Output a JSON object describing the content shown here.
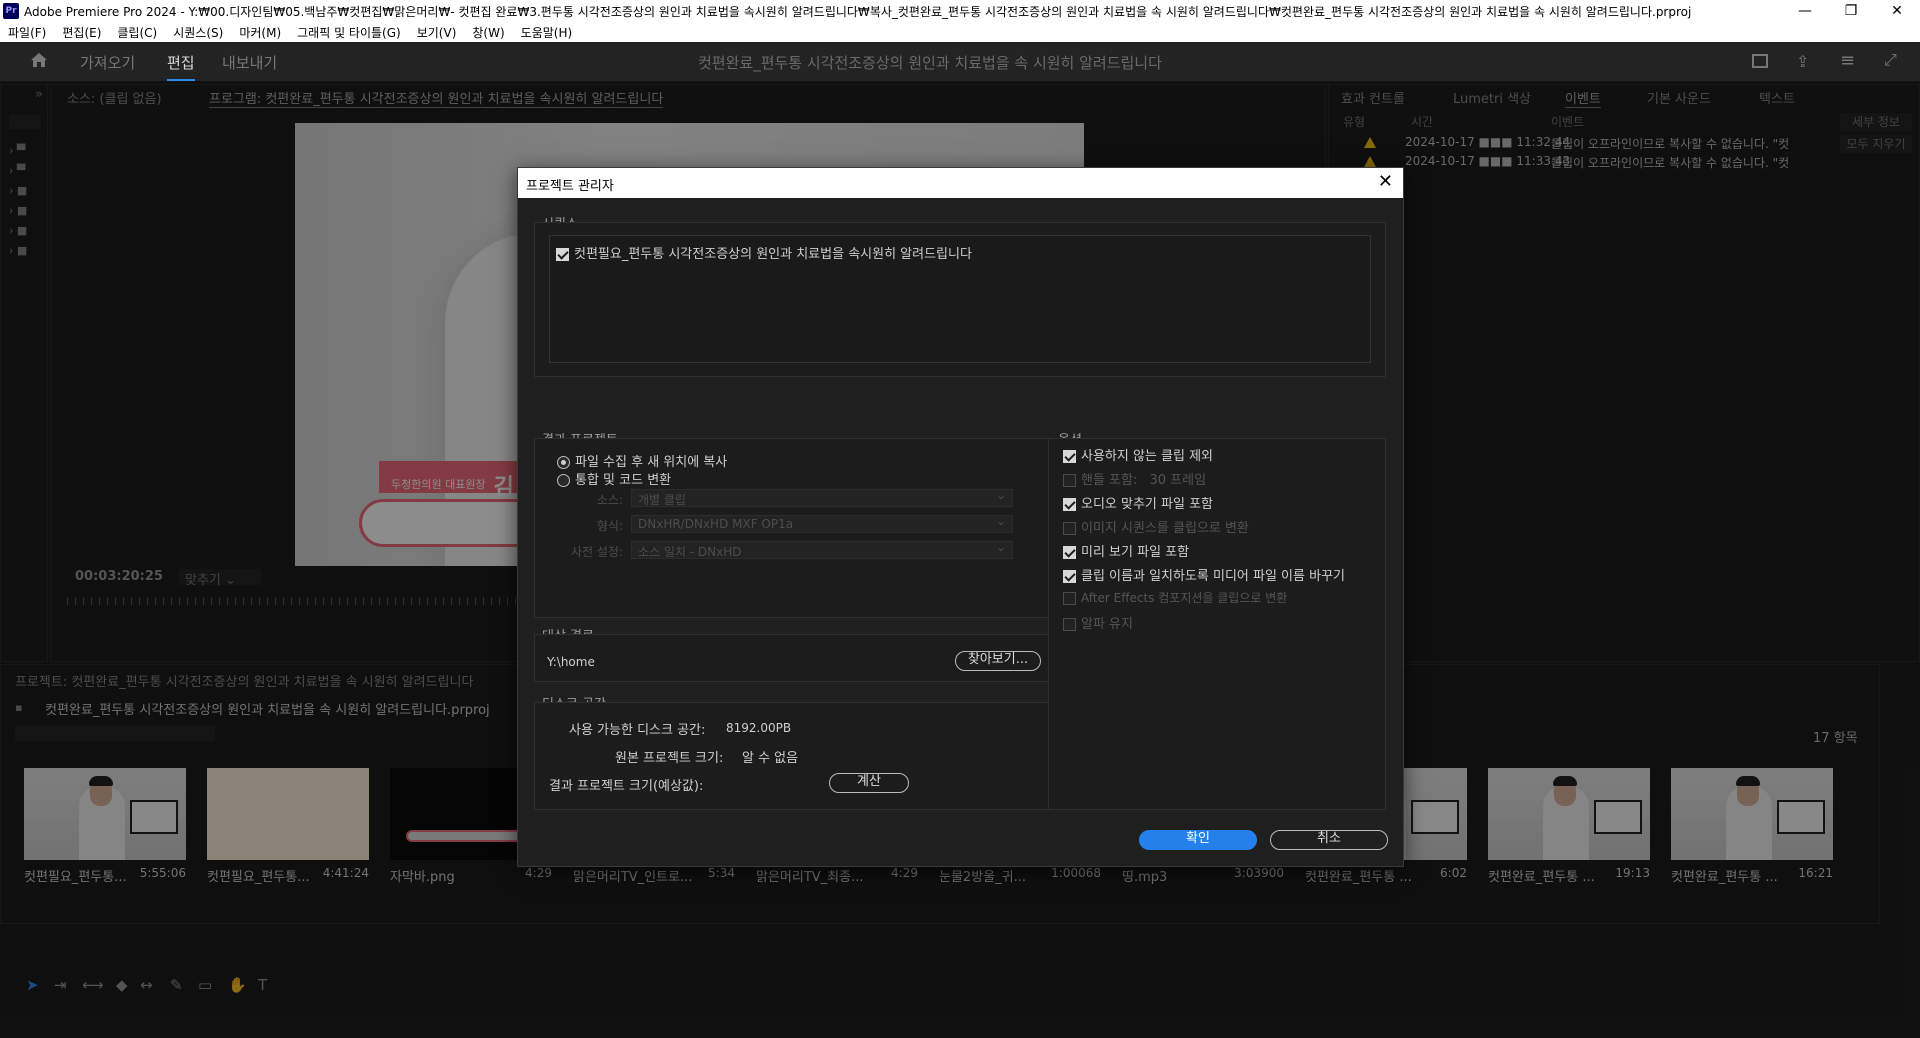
{
  "titlebar": {
    "app_icon": "Pr",
    "title": "Adobe Premiere Pro 2024 - Y:₩00.디자인팀₩05.백남주₩컷편집₩맑은머리₩- 컷편집 완료₩3.편두통 시각전조증상의 원인과 치료법을 속시원히 알려드립니다₩복사_컷편완료_편두통 시각전조증상의 원인과 치료법을 속 시원히 알려드립니다₩컷편완료_편두통 시각전조증상의 원인과 치료법을 속 시원히 알려드립니다.prproj",
    "minimize": "—",
    "maximize": "❐",
    "close": "✕"
  },
  "menu": [
    "파일(F)",
    "편집(E)",
    "클립(C)",
    "시퀀스(S)",
    "마커(M)",
    "그래픽 및 타이틀(G)",
    "보기(V)",
    "창(W)",
    "도움말(H)"
  ],
  "appbar": {
    "tabs": [
      "가져오기",
      "편집",
      "내보내기"
    ],
    "active": "편집",
    "doc_title": "컷편완료_편두통 시각전조증상의 원인과 치료법을 속 시원히 알려드립니다"
  },
  "source_panel": {
    "source_tab": "소스: (클립 없음)",
    "program_tab": "프로그램: 컷편완료_편두통 시각전조증상의 원인과 치료법을 속시원히 알려드립니다",
    "timecode": "00:03:20:25",
    "fit": "맞추기",
    "lower_third": "두청한의원 대표원장",
    "lower_third_name": "김"
  },
  "effects_panel": {
    "tabs": [
      "효과 컨트롤",
      "Lumetri 색상",
      "이벤트",
      "기본 사운드",
      "텍스트"
    ],
    "active": "이벤트",
    "columns": [
      "유형",
      "시간",
      "이벤트"
    ],
    "rows": [
      {
        "time": "2024-10-17 ■■■ 11:32:44",
        "event": "클립이 오프라인이므로 복사할 수 없습니다. \"컷"
      },
      {
        "time": "2024-10-17 ■■■ 11:33:43",
        "event": "클립이 오프라인이므로 복사할 수 없습니다. \"컷"
      }
    ],
    "side_buttons": [
      "세부 정보",
      "모두 지우기"
    ]
  },
  "project_panel": {
    "tab": "프로젝트: 컷편완료_편두통 시각전조증상의 원인과 치료법을 속 시원히 알려드립니다",
    "file": "컷편완료_편두통 시각전조증상의 원인과 치료법을 속 시원히 알려드립니다.prproj",
    "count": "17 항목",
    "clips": [
      {
        "name": "컷편필요_편두통...",
        "dur": "5:55:06"
      },
      {
        "name": "컷편필요_편두통...",
        "dur": "4:41:24"
      },
      {
        "name": "자막바.png",
        "dur": "4:29"
      },
      {
        "name": "맑은머리TV_인트로...",
        "dur": "5:34"
      },
      {
        "name": "맑은머리TV_최종...",
        "dur": "4:29"
      },
      {
        "name": "눈물2방울_귀...",
        "dur": "1:00068"
      },
      {
        "name": "띵.mp3",
        "dur": "3:03900"
      },
      {
        "name": "컷편완료_편두통 ...",
        "dur": "6:02"
      },
      {
        "name": "컷편완료_편두통 ...",
        "dur": "19:13"
      },
      {
        "name": "컷편완료_편두통 ...",
        "dur": "16:21"
      }
    ]
  },
  "dialog": {
    "title": "프로젝트 관리자",
    "close": "✕",
    "sequence_label": "시퀀스",
    "sequence_item": "컷편필요_편두통 시각전조증상의 원인과 치료법을 속시원히 알려드립니다",
    "result_label": "결과 프로젝트",
    "radio1": "파일 수집 후 새 위치에 복사",
    "radio2": "통합 및 코드 변환",
    "source_label": "소스:",
    "source_value": "개별 클립",
    "format_label": "형식:",
    "format_value": "DNxHR/DNxHD MXF OP1a",
    "preset_label": "사전 설정:",
    "preset_value": "소스 일치 - DNxHD",
    "dest_label": "대상 경로",
    "dest_path": "Y:\\home",
    "browse": "찾아보기...",
    "disk_label": "디스크 공간",
    "avail_label": "사용 가능한 디스크 공간:",
    "avail_value": "8192.00PB",
    "orig_label": "원본 프로젝트 크기:",
    "orig_value": "알 수 없음",
    "result_size_label": "결과 프로젝트 크기(예상값):",
    "calc": "계산",
    "options_label": "옵션",
    "options": [
      {
        "label": "사용하지 않는 클립 제외",
        "checked": true,
        "enabled": true
      },
      {
        "label": "핸들 포함:",
        "checked": false,
        "enabled": false,
        "suffix": "30 프레임"
      },
      {
        "label": "오디오 맞추기 파일 포함",
        "checked": true,
        "enabled": true
      },
      {
        "label": "이미지 시퀀스를 클립으로 변환",
        "checked": false,
        "enabled": false
      },
      {
        "label": "미리 보기 파일 포함",
        "checked": true,
        "enabled": true
      },
      {
        "label": "클립 이름과 일치하도록 미디어 파일 이름 바꾸기",
        "checked": true,
        "enabled": true
      },
      {
        "label": "After Effects 컴포지션을 클립으로 변환",
        "checked": false,
        "enabled": false
      },
      {
        "label": "알파 유지",
        "checked": false,
        "enabled": false
      }
    ],
    "ok": "확인",
    "cancel": "취소"
  },
  "colors": {
    "accent": "#2680eb",
    "warning": "#f4c20d",
    "bg": "#1d1d1d",
    "lower_third_bg": "#ef6a7a"
  }
}
